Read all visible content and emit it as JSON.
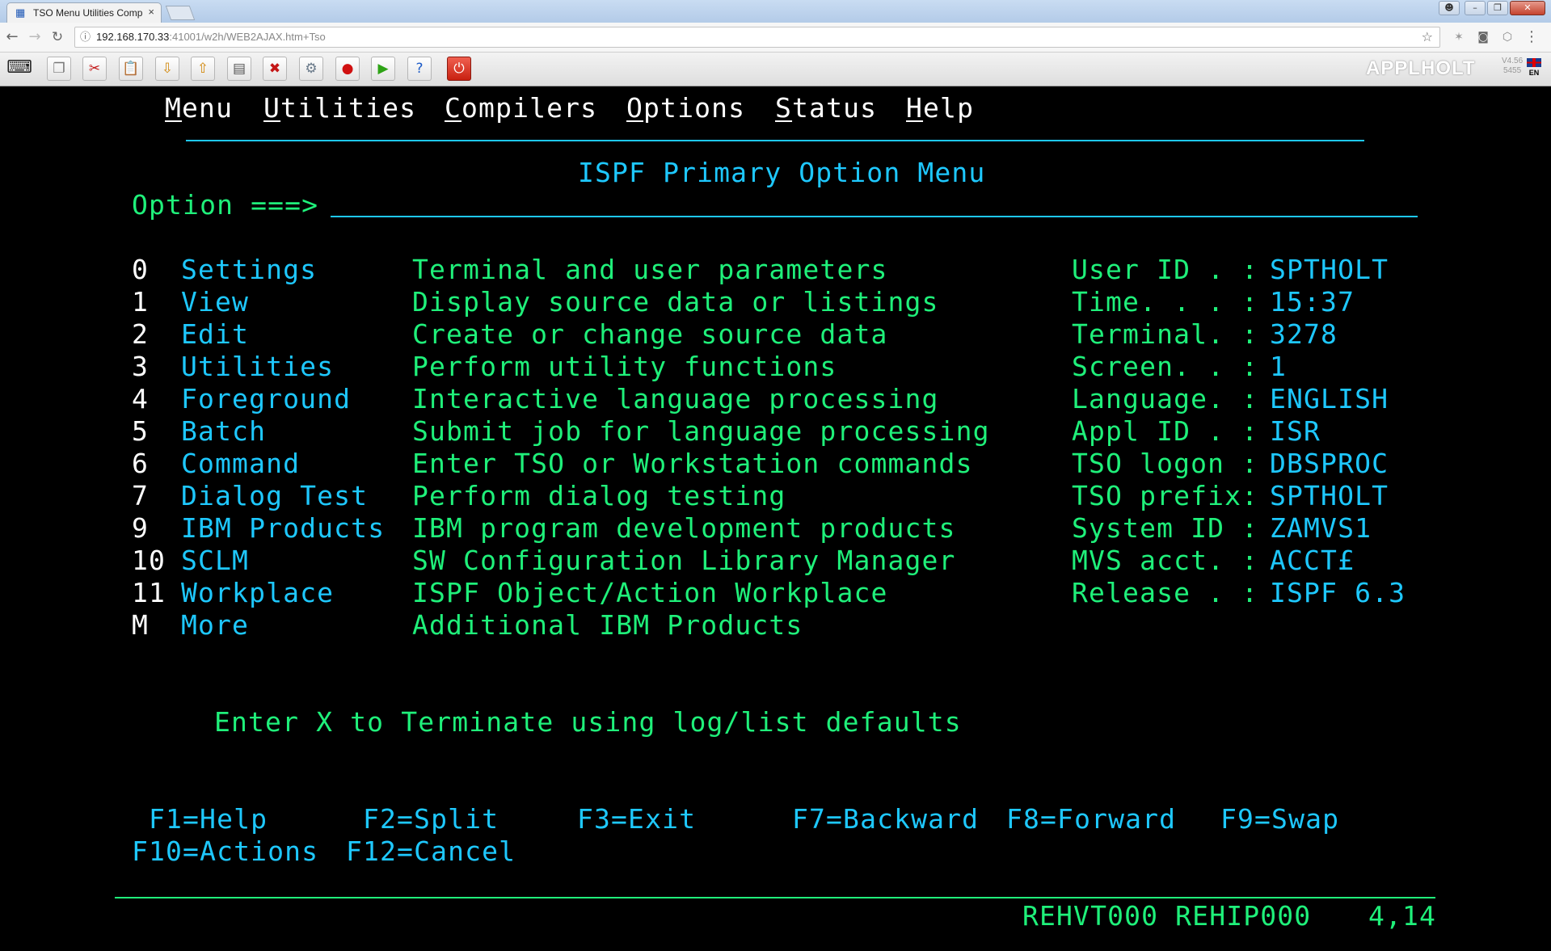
{
  "browser": {
    "tab_title": "TSO Menu Utilities Comp",
    "tab_close": "×",
    "url_host": "192.168.170.33",
    "url_path": ":41001/w2h/WEB2AJAX.htm+Tso"
  },
  "toolbar": {
    "brand": "APPLHOLT",
    "version": "V4.56",
    "build": "5455",
    "language": "EN",
    "icons": [
      "keyboard-icon",
      "copy-icon",
      "cut-icon",
      "paste-icon",
      "download-icon",
      "upload-icon",
      "print-icon",
      "disconnect-icon",
      "settings-icon",
      "record-icon",
      "play-icon",
      "help-icon",
      "power-icon"
    ]
  },
  "menubar": [
    {
      "key": "M",
      "rest": "enu"
    },
    {
      "key": "U",
      "rest": "tilities"
    },
    {
      "key": "C",
      "rest": "ompilers"
    },
    {
      "key": "O",
      "rest": "ptions"
    },
    {
      "key": "S",
      "rest": "tatus"
    },
    {
      "key": "H",
      "rest": "elp"
    }
  ],
  "panel": {
    "title": "ISPF Primary Option Menu",
    "option_label": "Option ===>",
    "option_value": ""
  },
  "options": [
    {
      "num": "0",
      "name": "Settings",
      "desc": "Terminal and user parameters"
    },
    {
      "num": "1",
      "name": "View",
      "desc": "Display source data or listings"
    },
    {
      "num": "2",
      "name": "Edit",
      "desc": "Create or change source data"
    },
    {
      "num": "3",
      "name": "Utilities",
      "desc": "Perform utility functions"
    },
    {
      "num": "4",
      "name": "Foreground",
      "desc": "Interactive language processing"
    },
    {
      "num": "5",
      "name": "Batch",
      "desc": "Submit job for language processing"
    },
    {
      "num": "6",
      "name": "Command",
      "desc": "Enter TSO or Workstation commands"
    },
    {
      "num": "7",
      "name": "Dialog Test",
      "desc": "Perform dialog testing"
    },
    {
      "num": "9",
      "name": "IBM Products",
      "desc": "IBM program development products"
    },
    {
      "num": "10",
      "name": "SCLM",
      "desc": "SW Configuration Library Manager"
    },
    {
      "num": "11",
      "name": "Workplace",
      "desc": "ISPF Object/Action Workplace"
    },
    {
      "num": "M",
      "name": "More",
      "desc": "Additional IBM Products"
    }
  ],
  "userinfo": [
    {
      "label": "User ID . :",
      "value": "SPTHOLT"
    },
    {
      "label": "Time. . . :",
      "value": "15:37"
    },
    {
      "label": "Terminal. :",
      "value": "3278"
    },
    {
      "label": "Screen. . :",
      "value": "1"
    },
    {
      "label": "Language. :",
      "value": "ENGLISH"
    },
    {
      "label": "Appl ID . :",
      "value": "ISR"
    },
    {
      "label": "TSO logon :",
      "value": "DBSPROC"
    },
    {
      "label": "TSO prefix:",
      "value": "SPTHOLT"
    },
    {
      "label": "System ID :",
      "value": "ZAMVS1"
    },
    {
      "label": "MVS acct. :",
      "value": "ACCT£"
    },
    {
      "label": "Release . :",
      "value": "ISPF 6.3"
    }
  ],
  "terminate_msg": "Enter X to Terminate using log/list defaults",
  "fkeys": {
    "row1": [
      "F1=Help",
      "F2=Split",
      "F3=Exit",
      "F7=Backward",
      "F8=Forward",
      "F9=Swap"
    ],
    "row2": [
      "F10=Actions",
      "F12=Cancel"
    ]
  },
  "status": {
    "ids": "REHVT000 REHIP000",
    "cursor": "4,14"
  },
  "colors": {
    "terminal_bg": "#000000",
    "green": "#1ff07a",
    "cyan": "#1ec8ff",
    "white": "#ffffff"
  }
}
